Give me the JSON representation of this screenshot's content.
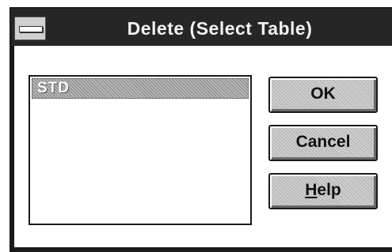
{
  "window": {
    "title": "Delete (Select Table)",
    "system_menu_icon": "minus-bar-icon"
  },
  "list": {
    "items": [
      {
        "label": "STD",
        "selected": true
      }
    ]
  },
  "buttons": {
    "ok_label": "OK",
    "cancel_label": "Cancel",
    "help_label_first": "H",
    "help_label_rest": "elp"
  }
}
